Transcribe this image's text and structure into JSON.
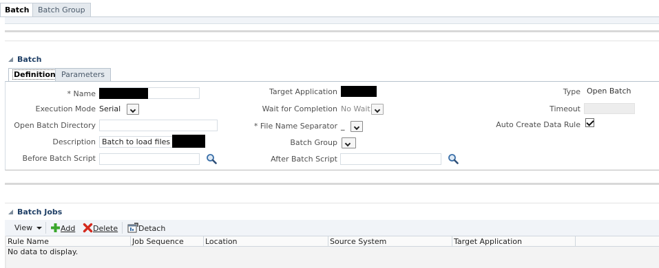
{
  "top_tabs": [
    {
      "label": "Batch",
      "active": true
    },
    {
      "label": "Batch Group",
      "active": false
    }
  ],
  "batch_section": {
    "title": "Batch",
    "sub_tabs": [
      {
        "label": "Definition",
        "active": true
      },
      {
        "label": "Parameters",
        "active": false
      }
    ],
    "fields": {
      "name": {
        "label": "* Name",
        "value": ""
      },
      "execution_mode": {
        "label": "Execution Mode",
        "value": "Serial"
      },
      "open_batch_directory": {
        "label": "Open Batch Directory",
        "value": ""
      },
      "description": {
        "label": "Description",
        "value": "Batch to load files for"
      },
      "before_batch_script": {
        "label": "Before Batch Script",
        "value": ""
      },
      "target_application": {
        "label": "Target Application",
        "value": ""
      },
      "wait_for_completion": {
        "label": "Wait for Completion",
        "value": "No Wait"
      },
      "file_name_separator": {
        "label": "* File Name Separator",
        "value": "_"
      },
      "batch_group": {
        "label": "Batch Group",
        "value": ""
      },
      "after_batch_script": {
        "label": "After Batch Script",
        "value": ""
      },
      "type": {
        "label": "Type",
        "value": "Open Batch"
      },
      "timeout": {
        "label": "Timeout",
        "value": ""
      },
      "auto_create_data_rule": {
        "label": "Auto Create Data Rule",
        "checked": true
      }
    }
  },
  "jobs_section": {
    "title": "Batch Jobs",
    "toolbar": {
      "view_label": "View",
      "add_label": "Add",
      "delete_label": "Delete",
      "detach_label": "Detach"
    },
    "columns": [
      "Rule Name",
      "Job Sequence",
      "Location",
      "Source System",
      "Target Application"
    ],
    "empty_message": "No data to display."
  },
  "colors": {
    "section_title": "#1f3f66",
    "tab_inactive_bg": "#e4e9ee",
    "toolbar_bg": "#f1f4f8",
    "add_icon": "#3aa62c",
    "delete_icon": "#d42a1e",
    "search_icon": "#3a6fa8"
  },
  "icons": {
    "search": "magnifier-icon",
    "add": "plus-icon",
    "delete": "red-x-icon",
    "detach": "detach-window-icon",
    "collapse": "disclosure-triangle-icon",
    "dropdown": "chevron-down-icon"
  }
}
